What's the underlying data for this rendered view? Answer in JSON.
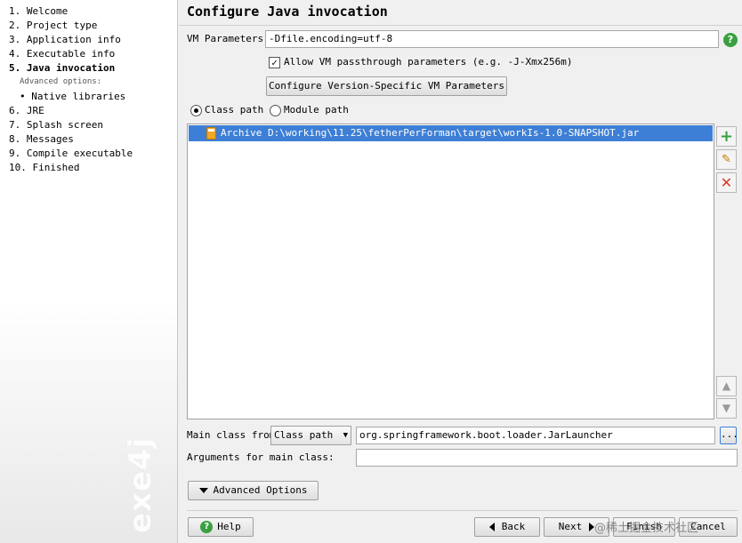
{
  "sidebar": {
    "steps": [
      {
        "label": "1.  Welcome"
      },
      {
        "label": "2.  Project type"
      },
      {
        "label": "3.  Application info"
      },
      {
        "label": "4.  Executable info"
      },
      {
        "label": "5.  Java invocation"
      },
      {
        "label": "Advanced options:"
      },
      {
        "label": "• Native libraries"
      },
      {
        "label": "6.  JRE"
      },
      {
        "label": "7.  Splash screen"
      },
      {
        "label": "8.  Messages"
      },
      {
        "label": "9.  Compile executable"
      },
      {
        "label": "10.  Finished"
      }
    ],
    "watermark": "exe4j"
  },
  "main": {
    "title": "Configure Java invocation",
    "vm_params_label": "VM Parameters:",
    "vm_params_value": "-Dfile.encoding=utf-8",
    "help_icon_glyph": "?",
    "passthrough_label": "Allow VM passthrough parameters (e.g. -J-Xmx256m)",
    "passthrough_checked": true,
    "configure_button": "Configure Version-Specific VM Parameters",
    "radio_classpath": "Class path",
    "radio_modulepath": "Module path",
    "classpath_entries": [
      {
        "text": "Archive D:\\working\\11.25\\fetherPerForman\\target\\workIs-1.0-SNAPSHOT.jar"
      }
    ],
    "main_class_from_label": "Main class from",
    "main_class_from_value": "Class path",
    "main_class_value": "org.springframework.boot.loader.JarLauncher",
    "browse_button": "...",
    "arguments_label": "Arguments for main class:",
    "arguments_value": "",
    "advanced_button": "Advanced Options"
  },
  "footer": {
    "help": "Help",
    "back": "Back",
    "next": "Next",
    "finish": "Finish",
    "cancel": "Cancel",
    "overlay_text": "@稀土掘金技术社区"
  },
  "colors": {
    "selection": "#3d7fd6",
    "add_green": "#3aa040",
    "remove_red": "#d23a2a"
  }
}
